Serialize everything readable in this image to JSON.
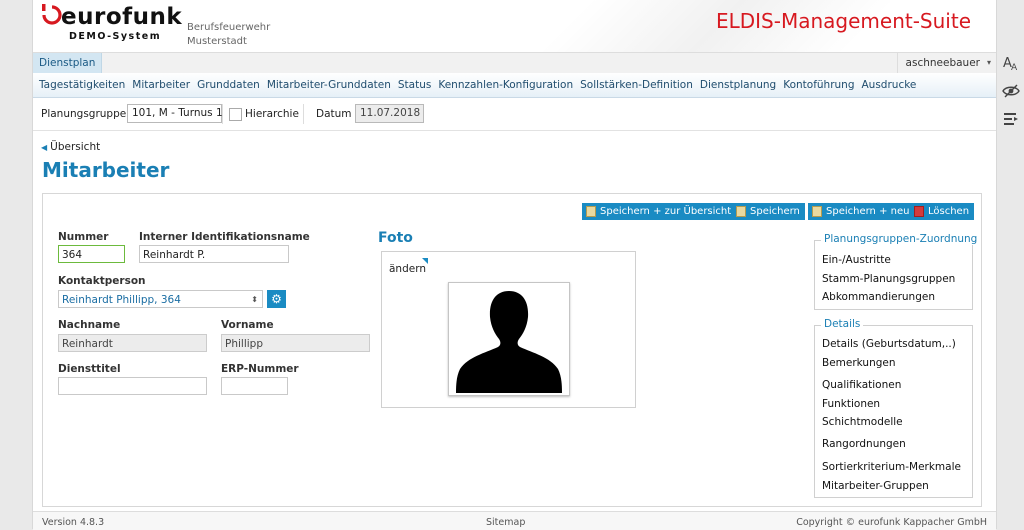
{
  "header": {
    "logo_text": "eurofunk",
    "logo_sub": "DEMO-System",
    "org_line1": "Berufsfeuerwehr",
    "org_line2": "Musterstadt",
    "suite_title": "ELDIS-Management-Suite",
    "brand_color": "#d71920"
  },
  "topbar": {
    "active_tab": "Dienstplan",
    "user": "aschneebauer"
  },
  "menu": [
    "Tagestätigkeiten",
    "Mitarbeiter",
    "Grunddaten",
    "Mitarbeiter-Grunddaten",
    "Status",
    "Kennzahlen-Konfiguration",
    "Sollstärken-Definition",
    "Dienstplanung",
    "Kontoführung",
    "Ausdrucke"
  ],
  "filter": {
    "planungsgruppe_label": "Planungsgruppe",
    "planungsgruppe_value": "101, M - Turnus 1",
    "hierarchie_label": "Hierarchie",
    "datum_label": "Datum",
    "datum_value": "11.07.2018"
  },
  "page": {
    "back_label": "Übersicht",
    "title": "Mitarbeiter",
    "accent_color": "#1a7fb4"
  },
  "actions": {
    "save_overview": "Speichern + zur Übersicht",
    "save": "Speichern",
    "save_new": "Speichern + neu",
    "delete": "Löschen"
  },
  "form": {
    "nummer_label": "Nummer",
    "nummer_value": "364",
    "intern_label": "Interner Identifikationsname",
    "intern_value": "Reinhardt P.",
    "kontakt_label": "Kontaktperson",
    "kontakt_value": "Reinhardt Phillipp, 364",
    "nachname_label": "Nachname",
    "nachname_value": "Reinhardt",
    "vorname_label": "Vorname",
    "vorname_value": "Phillipp",
    "diensttitel_label": "Diensttitel",
    "diensttitel_value": "",
    "erp_label": "ERP-Nummer",
    "erp_value": ""
  },
  "foto": {
    "title": "Foto",
    "change_label": "ändern"
  },
  "planungsgruppen": {
    "title": "Planungsgruppen-Zuordnung",
    "items": [
      "Ein-/Austritte",
      "Stamm-Planungsgruppen",
      "Abkommandierungen"
    ]
  },
  "details": {
    "title": "Details",
    "items": [
      "Details (Geburtsdatum,..)",
      "Bemerkungen",
      "Qualifikationen",
      "Funktionen",
      "Schichtmodelle",
      "Rangordnungen",
      "Sortierkriterium-Merkmale",
      "Mitarbeiter-Gruppen"
    ]
  },
  "footer": {
    "version": "Version 4.8.3",
    "sitemap": "Sitemap",
    "copyright": "Copyright © eurofunk Kappacher GmbH"
  },
  "sidetools": {
    "icons": [
      "font-size-icon",
      "visibility-icon",
      "list-indent-icon"
    ]
  }
}
